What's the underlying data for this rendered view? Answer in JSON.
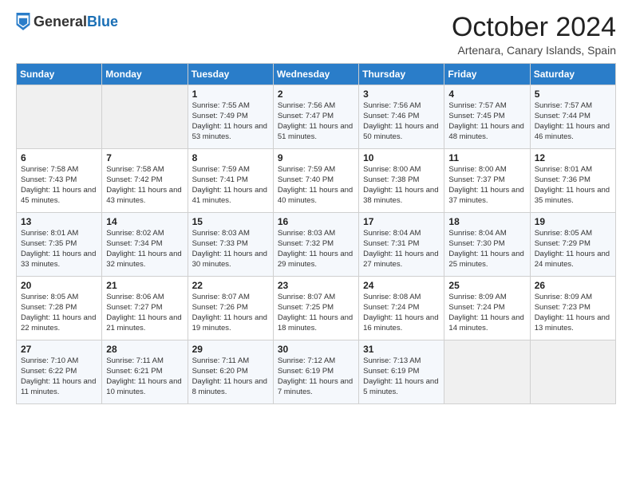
{
  "header": {
    "logo_general": "General",
    "logo_blue": "Blue",
    "month": "October 2024",
    "location": "Artenara, Canary Islands, Spain"
  },
  "days_of_week": [
    "Sunday",
    "Monday",
    "Tuesday",
    "Wednesday",
    "Thursday",
    "Friday",
    "Saturday"
  ],
  "weeks": [
    [
      {
        "day": "",
        "info": ""
      },
      {
        "day": "",
        "info": ""
      },
      {
        "day": "1",
        "info": "Sunrise: 7:55 AM\nSunset: 7:49 PM\nDaylight: 11 hours and 53 minutes."
      },
      {
        "day": "2",
        "info": "Sunrise: 7:56 AM\nSunset: 7:47 PM\nDaylight: 11 hours and 51 minutes."
      },
      {
        "day": "3",
        "info": "Sunrise: 7:56 AM\nSunset: 7:46 PM\nDaylight: 11 hours and 50 minutes."
      },
      {
        "day": "4",
        "info": "Sunrise: 7:57 AM\nSunset: 7:45 PM\nDaylight: 11 hours and 48 minutes."
      },
      {
        "day": "5",
        "info": "Sunrise: 7:57 AM\nSunset: 7:44 PM\nDaylight: 11 hours and 46 minutes."
      }
    ],
    [
      {
        "day": "6",
        "info": "Sunrise: 7:58 AM\nSunset: 7:43 PM\nDaylight: 11 hours and 45 minutes."
      },
      {
        "day": "7",
        "info": "Sunrise: 7:58 AM\nSunset: 7:42 PM\nDaylight: 11 hours and 43 minutes."
      },
      {
        "day": "8",
        "info": "Sunrise: 7:59 AM\nSunset: 7:41 PM\nDaylight: 11 hours and 41 minutes."
      },
      {
        "day": "9",
        "info": "Sunrise: 7:59 AM\nSunset: 7:40 PM\nDaylight: 11 hours and 40 minutes."
      },
      {
        "day": "10",
        "info": "Sunrise: 8:00 AM\nSunset: 7:38 PM\nDaylight: 11 hours and 38 minutes."
      },
      {
        "day": "11",
        "info": "Sunrise: 8:00 AM\nSunset: 7:37 PM\nDaylight: 11 hours and 37 minutes."
      },
      {
        "day": "12",
        "info": "Sunrise: 8:01 AM\nSunset: 7:36 PM\nDaylight: 11 hours and 35 minutes."
      }
    ],
    [
      {
        "day": "13",
        "info": "Sunrise: 8:01 AM\nSunset: 7:35 PM\nDaylight: 11 hours and 33 minutes."
      },
      {
        "day": "14",
        "info": "Sunrise: 8:02 AM\nSunset: 7:34 PM\nDaylight: 11 hours and 32 minutes."
      },
      {
        "day": "15",
        "info": "Sunrise: 8:03 AM\nSunset: 7:33 PM\nDaylight: 11 hours and 30 minutes."
      },
      {
        "day": "16",
        "info": "Sunrise: 8:03 AM\nSunset: 7:32 PM\nDaylight: 11 hours and 29 minutes."
      },
      {
        "day": "17",
        "info": "Sunrise: 8:04 AM\nSunset: 7:31 PM\nDaylight: 11 hours and 27 minutes."
      },
      {
        "day": "18",
        "info": "Sunrise: 8:04 AM\nSunset: 7:30 PM\nDaylight: 11 hours and 25 minutes."
      },
      {
        "day": "19",
        "info": "Sunrise: 8:05 AM\nSunset: 7:29 PM\nDaylight: 11 hours and 24 minutes."
      }
    ],
    [
      {
        "day": "20",
        "info": "Sunrise: 8:05 AM\nSunset: 7:28 PM\nDaylight: 11 hours and 22 minutes."
      },
      {
        "day": "21",
        "info": "Sunrise: 8:06 AM\nSunset: 7:27 PM\nDaylight: 11 hours and 21 minutes."
      },
      {
        "day": "22",
        "info": "Sunrise: 8:07 AM\nSunset: 7:26 PM\nDaylight: 11 hours and 19 minutes."
      },
      {
        "day": "23",
        "info": "Sunrise: 8:07 AM\nSunset: 7:25 PM\nDaylight: 11 hours and 18 minutes."
      },
      {
        "day": "24",
        "info": "Sunrise: 8:08 AM\nSunset: 7:24 PM\nDaylight: 11 hours and 16 minutes."
      },
      {
        "day": "25",
        "info": "Sunrise: 8:09 AM\nSunset: 7:24 PM\nDaylight: 11 hours and 14 minutes."
      },
      {
        "day": "26",
        "info": "Sunrise: 8:09 AM\nSunset: 7:23 PM\nDaylight: 11 hours and 13 minutes."
      }
    ],
    [
      {
        "day": "27",
        "info": "Sunrise: 7:10 AM\nSunset: 6:22 PM\nDaylight: 11 hours and 11 minutes."
      },
      {
        "day": "28",
        "info": "Sunrise: 7:11 AM\nSunset: 6:21 PM\nDaylight: 11 hours and 10 minutes."
      },
      {
        "day": "29",
        "info": "Sunrise: 7:11 AM\nSunset: 6:20 PM\nDaylight: 11 hours and 8 minutes."
      },
      {
        "day": "30",
        "info": "Sunrise: 7:12 AM\nSunset: 6:19 PM\nDaylight: 11 hours and 7 minutes."
      },
      {
        "day": "31",
        "info": "Sunrise: 7:13 AM\nSunset: 6:19 PM\nDaylight: 11 hours and 5 minutes."
      },
      {
        "day": "",
        "info": ""
      },
      {
        "day": "",
        "info": ""
      }
    ]
  ]
}
